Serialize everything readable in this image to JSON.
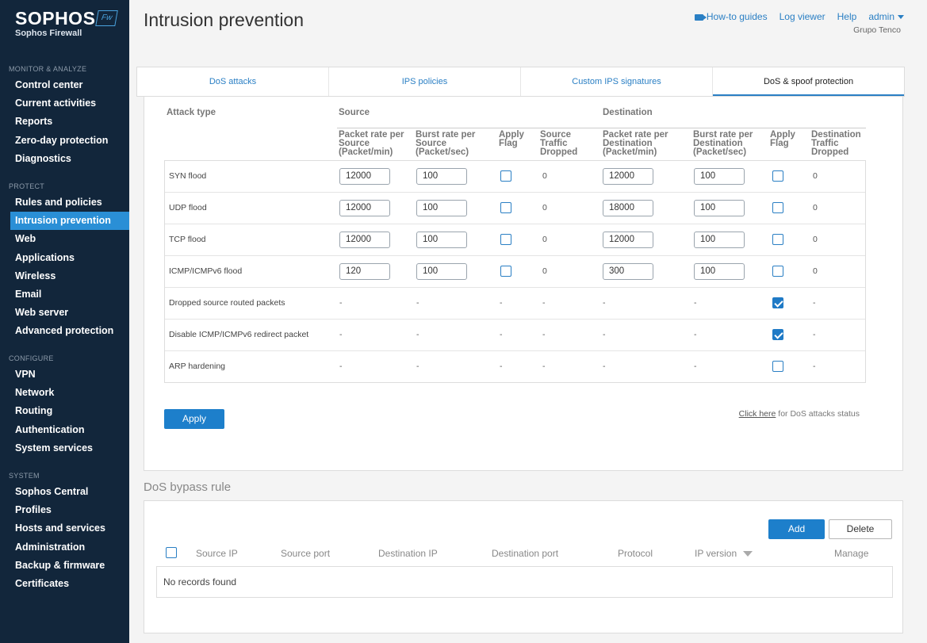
{
  "brand": {
    "name": "SOPHOS",
    "badge": "Fw",
    "product": "Sophos Firewall"
  },
  "sidebar": {
    "sections": [
      {
        "title": "MONITOR & ANALYZE",
        "items": [
          "Control center",
          "Current activities",
          "Reports",
          "Zero-day protection",
          "Diagnostics"
        ]
      },
      {
        "title": "PROTECT",
        "items": [
          "Rules and policies",
          "Intrusion prevention",
          "Web",
          "Applications",
          "Wireless",
          "Email",
          "Web server",
          "Advanced protection"
        ]
      },
      {
        "title": "CONFIGURE",
        "items": [
          "VPN",
          "Network",
          "Routing",
          "Authentication",
          "System services"
        ]
      },
      {
        "title": "SYSTEM",
        "items": [
          "Sophos Central",
          "Profiles",
          "Hosts and services",
          "Administration",
          "Backup & firmware",
          "Certificates"
        ]
      }
    ],
    "active_item": "Intrusion prevention"
  },
  "header": {
    "title": "Intrusion prevention",
    "links": {
      "guides": "How-to guides",
      "log": "Log viewer",
      "help": "Help",
      "user": "admin"
    },
    "organization": "Grupo Tenco"
  },
  "tabs": [
    "DoS attacks",
    "IPS policies",
    "Custom IPS signatures",
    "DoS & spoof protection"
  ],
  "active_tab": "DoS & spoof protection",
  "dos_table": {
    "headers": {
      "attack_type": "Attack type",
      "source": "Source",
      "destination": "Destination",
      "src_packet": [
        "Packet rate per",
        "Source",
        "(Packet/min)"
      ],
      "src_burst": [
        "Burst rate per",
        "Source",
        "(Packet/sec)"
      ],
      "src_flag": [
        "Apply",
        "Flag"
      ],
      "src_dropped": [
        "Source",
        "Traffic",
        "Dropped"
      ],
      "dst_packet": [
        "Packet rate per",
        "Destination",
        "(Packet/min)"
      ],
      "dst_burst": [
        "Burst rate per",
        "Destination",
        "(Packet/sec)"
      ],
      "dst_flag": [
        "Apply",
        "Flag"
      ],
      "dst_dropped": [
        "Destination",
        "Traffic",
        "Dropped"
      ]
    },
    "rows": [
      {
        "label": "SYN flood",
        "src_packet": "12000",
        "src_burst": "100",
        "src_flag": false,
        "src_dropped": "0",
        "dst_packet": "12000",
        "dst_burst": "100",
        "dst_flag": false,
        "dst_dropped": "0",
        "editable": true
      },
      {
        "label": "UDP flood",
        "src_packet": "12000",
        "src_burst": "100",
        "src_flag": false,
        "src_dropped": "0",
        "dst_packet": "18000",
        "dst_burst": "100",
        "dst_flag": false,
        "dst_dropped": "0",
        "editable": true
      },
      {
        "label": "TCP flood",
        "src_packet": "12000",
        "src_burst": "100",
        "src_flag": false,
        "src_dropped": "0",
        "dst_packet": "12000",
        "dst_burst": "100",
        "dst_flag": false,
        "dst_dropped": "0",
        "editable": true
      },
      {
        "label": "ICMP/ICMPv6 flood",
        "src_packet": "120",
        "src_burst": "100",
        "src_flag": false,
        "src_dropped": "0",
        "dst_packet": "300",
        "dst_burst": "100",
        "dst_flag": false,
        "dst_dropped": "0",
        "editable": true
      },
      {
        "label": "Dropped source routed packets",
        "src_packet": "-",
        "src_burst": "-",
        "src_flag": "-",
        "src_dropped": "-",
        "dst_packet": "-",
        "dst_burst": "-",
        "dst_flag": true,
        "dst_dropped": "-",
        "editable": false
      },
      {
        "label": "Disable ICMP/ICMPv6 redirect packet",
        "src_packet": "-",
        "src_burst": "-",
        "src_flag": "-",
        "src_dropped": "-",
        "dst_packet": "-",
        "dst_burst": "-",
        "dst_flag": true,
        "dst_dropped": "-",
        "editable": false
      },
      {
        "label": "ARP hardening",
        "src_packet": "-",
        "src_burst": "-",
        "src_flag": "-",
        "src_dropped": "-",
        "dst_packet": "-",
        "dst_burst": "-",
        "dst_flag": false,
        "dst_dropped": "-",
        "editable": false
      }
    ],
    "apply_label": "Apply",
    "status_link": "Click here",
    "status_text": " for DoS attacks status"
  },
  "bypass": {
    "title": "DoS bypass rule",
    "add_label": "Add",
    "delete_label": "Delete",
    "columns": [
      "Source IP",
      "Source port",
      "Destination IP",
      "Destination port",
      "Protocol",
      "IP version",
      "Manage"
    ],
    "empty_text": "No records found"
  },
  "colors": {
    "sidebar_bg": "#12263b",
    "accent": "#1d7fcb",
    "active_nav": "#2a8fd6"
  }
}
